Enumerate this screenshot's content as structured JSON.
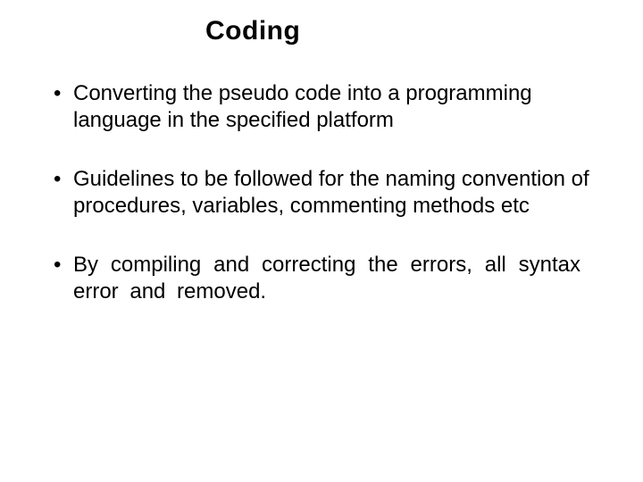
{
  "title": "Coding",
  "bullets": [
    "Converting  the pseudo code into a programming language in the specified platform",
    "Guidelines to be followed for  the naming convention of procedures, variables, commenting methods  etc",
    "By  compiling  and  correcting  the errors,  all syntax  error  and  removed."
  ]
}
